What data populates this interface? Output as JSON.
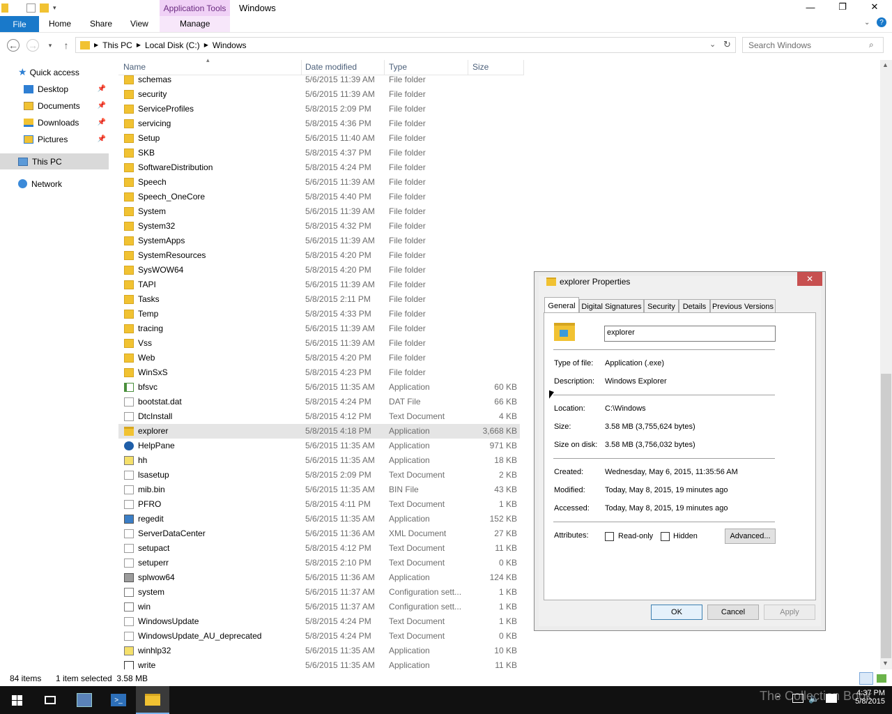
{
  "window": {
    "context_tab": "Application Tools",
    "title": "Windows",
    "min": "—",
    "max": "❐",
    "close": "✕"
  },
  "ribbon": {
    "file": "File",
    "tabs": [
      "Home",
      "Share",
      "View"
    ],
    "manage": "Manage"
  },
  "address": {
    "crumbs": [
      "This PC",
      "Local Disk (C:)",
      "Windows"
    ],
    "search_placeholder": "Search Windows"
  },
  "nav_pane": {
    "quick_access": "Quick access",
    "items": [
      "Desktop",
      "Documents",
      "Downloads",
      "Pictures"
    ],
    "this_pc": "This PC",
    "network": "Network"
  },
  "columns": [
    "Name",
    "Date modified",
    "Type",
    "Size"
  ],
  "files": [
    {
      "name": "schemas",
      "date": "5/6/2015 11:39 AM",
      "type": "File folder",
      "size": "",
      "kind": "folder"
    },
    {
      "name": "security",
      "date": "5/6/2015 11:39 AM",
      "type": "File folder",
      "size": "",
      "kind": "folder"
    },
    {
      "name": "ServiceProfiles",
      "date": "5/8/2015 2:09 PM",
      "type": "File folder",
      "size": "",
      "kind": "folder"
    },
    {
      "name": "servicing",
      "date": "5/8/2015 4:36 PM",
      "type": "File folder",
      "size": "",
      "kind": "folder"
    },
    {
      "name": "Setup",
      "date": "5/6/2015 11:40 AM",
      "type": "File folder",
      "size": "",
      "kind": "folder"
    },
    {
      "name": "SKB",
      "date": "5/8/2015 4:37 PM",
      "type": "File folder",
      "size": "",
      "kind": "folder"
    },
    {
      "name": "SoftwareDistribution",
      "date": "5/8/2015 4:24 PM",
      "type": "File folder",
      "size": "",
      "kind": "folder"
    },
    {
      "name": "Speech",
      "date": "5/6/2015 11:39 AM",
      "type": "File folder",
      "size": "",
      "kind": "folder"
    },
    {
      "name": "Speech_OneCore",
      "date": "5/8/2015 4:40 PM",
      "type": "File folder",
      "size": "",
      "kind": "folder"
    },
    {
      "name": "System",
      "date": "5/6/2015 11:39 AM",
      "type": "File folder",
      "size": "",
      "kind": "folder"
    },
    {
      "name": "System32",
      "date": "5/8/2015 4:32 PM",
      "type": "File folder",
      "size": "",
      "kind": "folder"
    },
    {
      "name": "SystemApps",
      "date": "5/6/2015 11:39 AM",
      "type": "File folder",
      "size": "",
      "kind": "folder"
    },
    {
      "name": "SystemResources",
      "date": "5/8/2015 4:20 PM",
      "type": "File folder",
      "size": "",
      "kind": "folder"
    },
    {
      "name": "SysWOW64",
      "date": "5/8/2015 4:20 PM",
      "type": "File folder",
      "size": "",
      "kind": "folder"
    },
    {
      "name": "TAPI",
      "date": "5/6/2015 11:39 AM",
      "type": "File folder",
      "size": "",
      "kind": "folder"
    },
    {
      "name": "Tasks",
      "date": "5/8/2015 2:11 PM",
      "type": "File folder",
      "size": "",
      "kind": "folder"
    },
    {
      "name": "Temp",
      "date": "5/8/2015 4:33 PM",
      "type": "File folder",
      "size": "",
      "kind": "folder"
    },
    {
      "name": "tracing",
      "date": "5/6/2015 11:39 AM",
      "type": "File folder",
      "size": "",
      "kind": "folder"
    },
    {
      "name": "Vss",
      "date": "5/6/2015 11:39 AM",
      "type": "File folder",
      "size": "",
      "kind": "folder"
    },
    {
      "name": "Web",
      "date": "5/8/2015 4:20 PM",
      "type": "File folder",
      "size": "",
      "kind": "folder"
    },
    {
      "name": "WinSxS",
      "date": "5/8/2015 4:23 PM",
      "type": "File folder",
      "size": "",
      "kind": "folder"
    },
    {
      "name": "bfsvc",
      "date": "5/6/2015 11:35 AM",
      "type": "Application",
      "size": "60 KB",
      "kind": "app"
    },
    {
      "name": "bootstat.dat",
      "date": "5/8/2015 4:24 PM",
      "type": "DAT File",
      "size": "66 KB",
      "kind": "doc"
    },
    {
      "name": "DtcInstall",
      "date": "5/8/2015 4:12 PM",
      "type": "Text Document",
      "size": "4 KB",
      "kind": "doc"
    },
    {
      "name": "explorer",
      "date": "5/8/2015 4:18 PM",
      "type": "Application",
      "size": "3,668 KB",
      "kind": "explorer",
      "selected": true
    },
    {
      "name": "HelpPane",
      "date": "5/6/2015 11:35 AM",
      "type": "Application",
      "size": "971 KB",
      "kind": "help"
    },
    {
      "name": "hh",
      "date": "5/6/2015 11:35 AM",
      "type": "Application",
      "size": "18 KB",
      "kind": "hh"
    },
    {
      "name": "lsasetup",
      "date": "5/8/2015 2:09 PM",
      "type": "Text Document",
      "size": "2 KB",
      "kind": "doc"
    },
    {
      "name": "mib.bin",
      "date": "5/6/2015 11:35 AM",
      "type": "BIN File",
      "size": "43 KB",
      "kind": "doc"
    },
    {
      "name": "PFRO",
      "date": "5/8/2015 4:11 PM",
      "type": "Text Document",
      "size": "1 KB",
      "kind": "doc"
    },
    {
      "name": "regedit",
      "date": "5/6/2015 11:35 AM",
      "type": "Application",
      "size": "152 KB",
      "kind": "regedit"
    },
    {
      "name": "ServerDataCenter",
      "date": "5/6/2015 11:36 AM",
      "type": "XML Document",
      "size": "27 KB",
      "kind": "doc"
    },
    {
      "name": "setupact",
      "date": "5/8/2015 4:12 PM",
      "type": "Text Document",
      "size": "11 KB",
      "kind": "doc"
    },
    {
      "name": "setuperr",
      "date": "5/8/2015 2:10 PM",
      "type": "Text Document",
      "size": "0 KB",
      "kind": "doc"
    },
    {
      "name": "splwow64",
      "date": "5/6/2015 11:36 AM",
      "type": "Application",
      "size": "124 KB",
      "kind": "printer"
    },
    {
      "name": "system",
      "date": "5/6/2015 11:37 AM",
      "type": "Configuration sett...",
      "size": "1 KB",
      "kind": "config"
    },
    {
      "name": "win",
      "date": "5/6/2015 11:37 AM",
      "type": "Configuration sett...",
      "size": "1 KB",
      "kind": "config"
    },
    {
      "name": "WindowsUpdate",
      "date": "5/8/2015 4:24 PM",
      "type": "Text Document",
      "size": "1 KB",
      "kind": "doc"
    },
    {
      "name": "WindowsUpdate_AU_deprecated",
      "date": "5/8/2015 4:24 PM",
      "type": "Text Document",
      "size": "0 KB",
      "kind": "doc"
    },
    {
      "name": "winhlp32",
      "date": "5/6/2015 11:35 AM",
      "type": "Application",
      "size": "10 KB",
      "kind": "hh"
    },
    {
      "name": "write",
      "date": "5/6/2015 11:35 AM",
      "type": "Application",
      "size": "11 KB",
      "kind": "write"
    }
  ],
  "status": {
    "count": "84 items",
    "selection": "1 item selected  3.58 MB"
  },
  "taskbar": {
    "time": "4:37 PM",
    "date": "5/8/2015",
    "watermark": "The Collection Book"
  },
  "dialog": {
    "title": "explorer Properties",
    "close": "✕",
    "tabs": [
      "General",
      "Digital Signatures",
      "Security",
      "Details",
      "Previous Versions"
    ],
    "filename": "explorer",
    "type_label": "Type of file:",
    "type_value": "Application (.exe)",
    "desc_label": "Description:",
    "desc_value": "Windows Explorer",
    "loc_label": "Location:",
    "loc_value": "C:\\Windows",
    "size_label": "Size:",
    "size_value": "3.58 MB (3,755,624 bytes)",
    "sod_label": "Size on disk:",
    "sod_value": "3.58 MB (3,756,032 bytes)",
    "created_label": "Created:",
    "created_value": "Wednesday, May 6, 2015, 11:35:56 AM",
    "modified_label": "Modified:",
    "modified_value": "Today, May 8, 2015, 19 minutes ago",
    "accessed_label": "Accessed:",
    "accessed_value": "Today, May 8, 2015, 19 minutes ago",
    "attr_label": "Attributes:",
    "readonly": "Read-only",
    "hidden": "Hidden",
    "advanced": "Advanced...",
    "ok": "OK",
    "cancel": "Cancel",
    "apply": "Apply"
  },
  "colors": {
    "accent": "#1979ca",
    "context": "#f0d1f6",
    "close": "#c75050",
    "taskbar": "#111111"
  }
}
